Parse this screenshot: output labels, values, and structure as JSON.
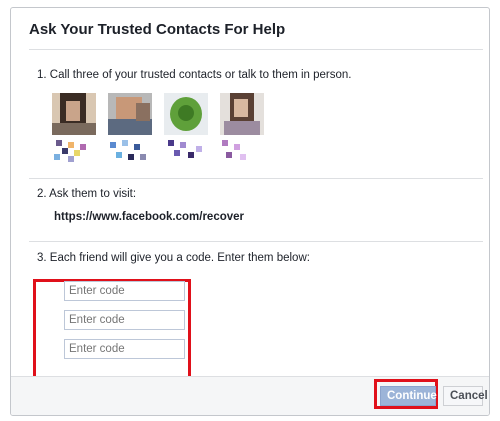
{
  "dialog": {
    "title": "Ask Your Trusted Contacts For Help",
    "step1": "1. Call three of your trusted contacts or talk to them in person.",
    "step2": "2. Ask them to visit:",
    "recover_url": "https://www.facebook.com/recover",
    "step3": "3. Each friend will give you a code. Enter them below:",
    "code_inputs": [
      {
        "placeholder": "Enter code",
        "value": ""
      },
      {
        "placeholder": "Enter code",
        "value": ""
      },
      {
        "placeholder": "Enter code",
        "value": ""
      }
    ],
    "buttons": {
      "continue": "Continue",
      "cancel": "Cancel"
    }
  },
  "colors": {
    "highlight": "#e0101a",
    "continue_bg": "#9cb4d8",
    "divider": "#dddfe2"
  }
}
